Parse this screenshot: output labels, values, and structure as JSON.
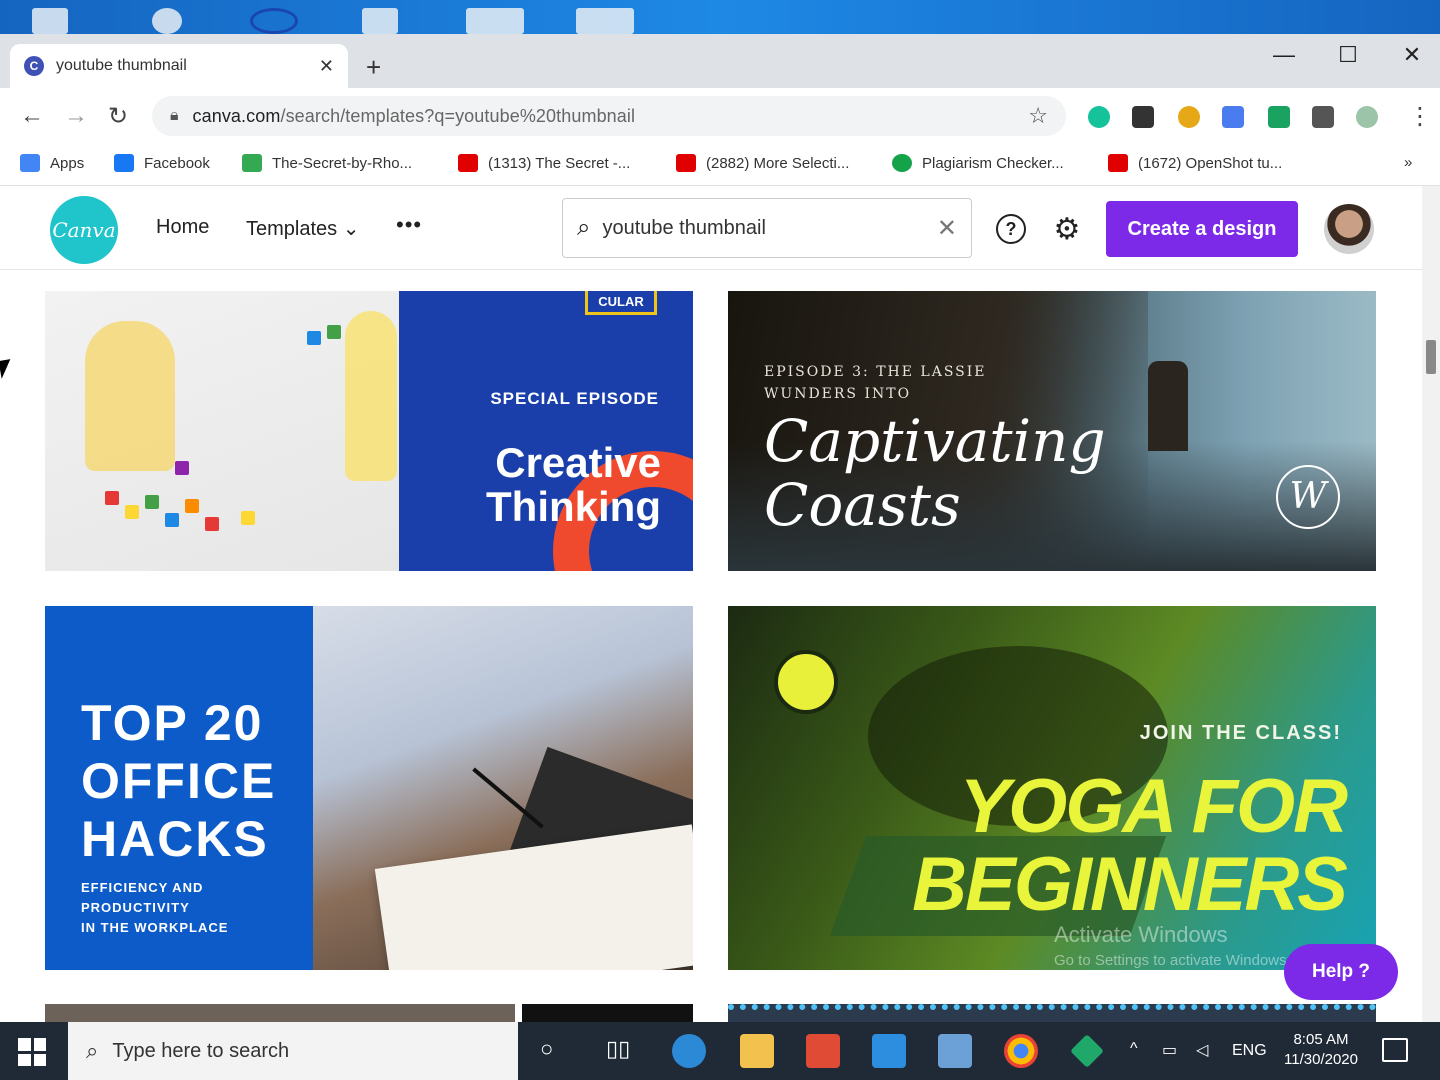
{
  "browser": {
    "tab_title": "youtube thumbnail",
    "tab_close": "✕",
    "new_tab": "+",
    "url_host": "canva.com",
    "url_path": "/search/templates?q=youtube%20thumbnail",
    "bookmarks": [
      {
        "label": "Apps",
        "color": "#4285f4"
      },
      {
        "label": "Facebook",
        "color": "#1877f2"
      },
      {
        "label": "The-Secret-by-Rho...",
        "color": "#34a853"
      },
      {
        "label": "(1313) The Secret -...",
        "color": "#e00000"
      },
      {
        "label": "(2882) More Selecti...",
        "color": "#e00000"
      },
      {
        "label": "Plagiarism Checker...",
        "color": "#15a34a"
      },
      {
        "label": "(1672) OpenShot tu...",
        "color": "#e00000"
      }
    ],
    "bookmarks_more": "»"
  },
  "canva": {
    "logo_text": "Canva",
    "nav_home": "Home",
    "nav_templates": "Templates ⌄",
    "nav_more": "•••",
    "search_value": "youtube thumbnail",
    "help_icon_text": "?",
    "settings_icon_text": "⚙",
    "create_button": "Create a design",
    "accent_color": "#7d2ae8"
  },
  "templates": [
    {
      "badge": "CULAR",
      "kicker": "SPECIAL EPISODE",
      "title_line1": "Creative",
      "title_line2": "Thinking"
    },
    {
      "kicker_line1": "EPISODE 3: THE LASSIE",
      "kicker_line2": "WUNDERS INTO",
      "title_line1": "Captivating",
      "title_line2": "Coasts",
      "monogram": "W"
    },
    {
      "title_line1": "TOP 20",
      "title_line2": "OFFICE",
      "title_line3": "HACKS",
      "sub_line1": "EFFICIENCY AND",
      "sub_line2": "PRODUCTIVITY",
      "sub_line3": "IN THE WORKPLACE"
    },
    {
      "kicker": "JOIN THE CLASS!",
      "title_line1": "YOGA FOR",
      "title_line2": "BEGINNERS"
    }
  ],
  "overlay": {
    "watermark_line1": "Activate Windows",
    "watermark_line2": "Go to Settings to activate Windows.",
    "help_button": "Help ?"
  },
  "taskbar": {
    "search_placeholder": "Type here to search",
    "language": "ENG",
    "time": "8:05 AM",
    "date": "11/30/2020"
  }
}
